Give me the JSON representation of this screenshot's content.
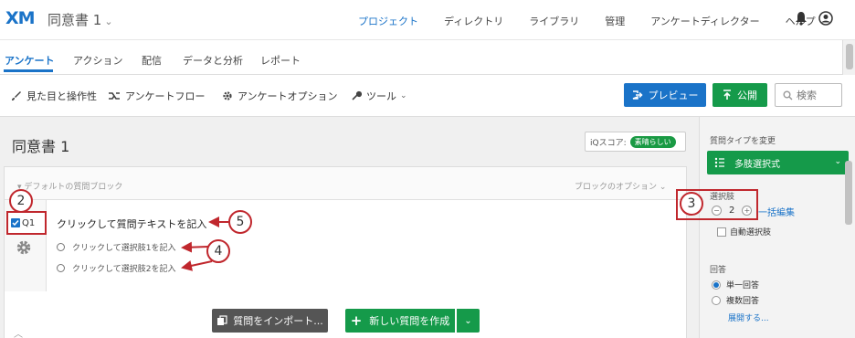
{
  "header": {
    "logo": "XM",
    "project_title": "同意書 1",
    "nav": [
      "プロジェクト",
      "ディレクトリ",
      "ライブラリ",
      "管理",
      "アンケートディレクター",
      "ヘルプ"
    ],
    "active_nav": "プロジェクト"
  },
  "tabs": [
    "アンケート",
    "アクション",
    "配信",
    "データと分析",
    "レポート"
  ],
  "toolbar": {
    "look_feel": "見た目と操作性",
    "survey_flow": "アンケートフロー",
    "survey_options": "アンケートオプション",
    "tools": "ツール",
    "preview": "プレビュー",
    "publish": "公開",
    "search_placeholder": "検索"
  },
  "editor": {
    "survey_title": "同意書 1",
    "iq_label": "iQスコア:",
    "iq_value": "素晴らしい",
    "block_name": "デフォルトの質問ブロック",
    "block_options": "ブロックのオプション",
    "question_id": "Q1",
    "question_text": "クリックして質問テキストを記入",
    "choices": [
      "クリックして選択肢1を記入",
      "クリックして選択肢2を記入"
    ],
    "import_button": "質問をインポート...",
    "new_question_button": "新しい質問を作成"
  },
  "panel": {
    "change_type_label": "質問タイプを変更",
    "question_type": "多肢選択式",
    "choices_label": "選択肢",
    "choice_count": "2",
    "bulk_edit": "一括編集",
    "auto_choices": "自動選択肢",
    "answer_label": "回答",
    "answers": [
      "単一回答",
      "複数回答"
    ],
    "selected_answer": "単一回答",
    "expand": "展開する..."
  },
  "callouts": [
    "2",
    "3",
    "4",
    "5"
  ],
  "colors": {
    "accent_blue": "#1a73c8",
    "publish_green": "#159a4a",
    "callout_red": "#c0272d"
  }
}
